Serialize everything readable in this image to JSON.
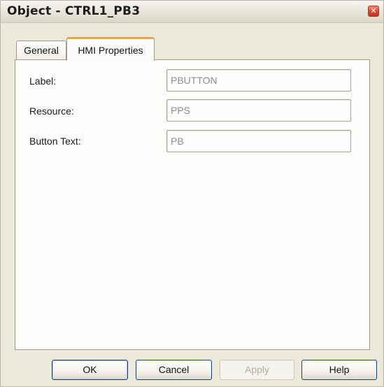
{
  "window": {
    "title": "Object - CTRL1_PB3",
    "close_glyph": "✕"
  },
  "tabs": [
    {
      "label": "General",
      "active": false
    },
    {
      "label": "HMI Properties",
      "active": true
    }
  ],
  "fields": [
    {
      "label": "Label:",
      "value": "PBUTTON"
    },
    {
      "label": "Resource:",
      "value": "PPS"
    },
    {
      "label": "Button Text:",
      "value": "PB"
    }
  ],
  "buttons": {
    "ok": "OK",
    "cancel": "Cancel",
    "apply": "Apply",
    "help": "Help"
  },
  "colors": {
    "active_tab_accent": "#f2a531",
    "close_button": "#d9452a",
    "default_button_border": "#1a3d7c"
  }
}
